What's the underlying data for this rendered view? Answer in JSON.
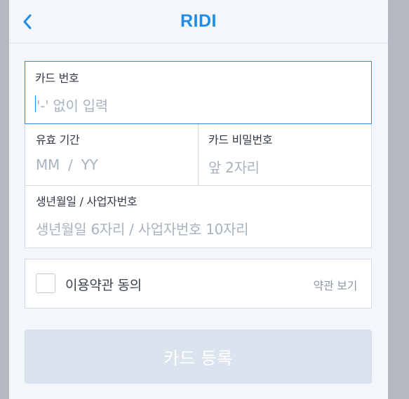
{
  "header": {
    "title": "RIDI",
    "back_icon": "chevron-left-icon"
  },
  "form": {
    "card_number": {
      "label": "카드 번호",
      "placeholder": "'-' 없이 입력"
    },
    "expiry": {
      "label": "유효 기간",
      "placeholder": "MM  /  YY"
    },
    "password": {
      "label": "카드 비밀번호",
      "placeholder": "앞 2자리"
    },
    "birth": {
      "label": "생년월일 / 사업자번호",
      "placeholder": "생년월일 6자리 / 사업자번호 10자리"
    }
  },
  "terms": {
    "label": "이용약관 동의",
    "link": "약관 보기"
  },
  "submit": {
    "label": "카드 등록"
  },
  "colors": {
    "accent": "#1f8ce6",
    "focus_border": "#2e8ce0",
    "placeholder": "#a8b3c0",
    "disabled_button": "#dbe4ee"
  }
}
